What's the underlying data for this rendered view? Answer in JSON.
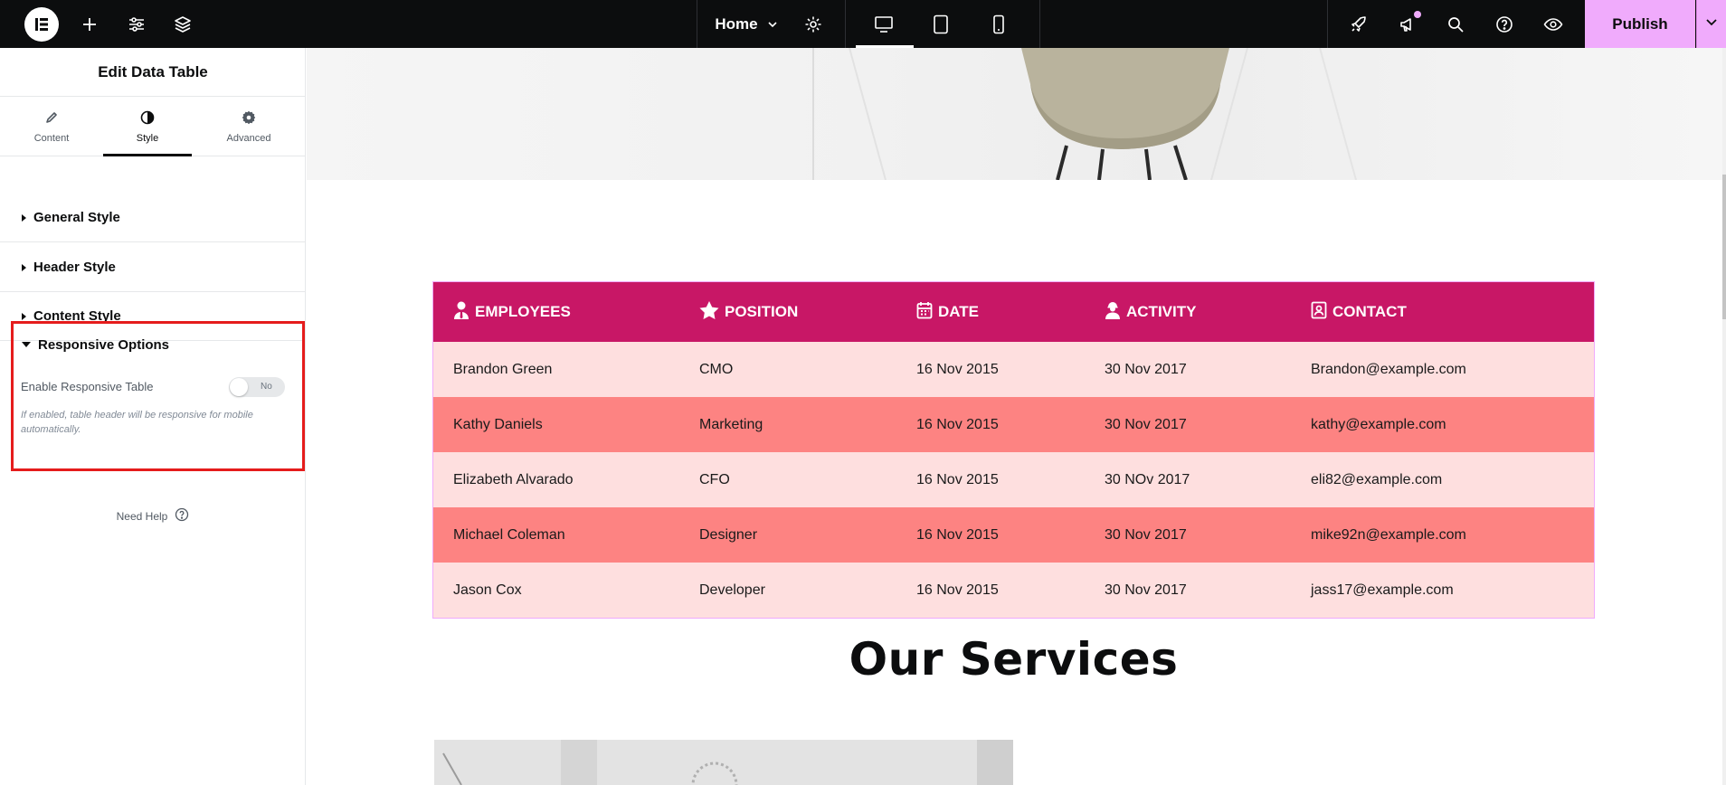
{
  "topbar": {
    "home_label": "Home",
    "publish_label": "Publish",
    "icons": [
      "elementor-logo-icon",
      "add-icon",
      "sliders-icon",
      "layers-icon",
      "chevron-down-icon",
      "gear-icon",
      "desktop-icon",
      "tablet-icon",
      "mobile-icon",
      "rocket-icon",
      "megaphone-icon",
      "search-icon",
      "help-icon",
      "eye-icon",
      "chevron-down-icon"
    ],
    "colors": {
      "bar": "#0c0d0e",
      "publish": "#f0abfc"
    }
  },
  "panel": {
    "title": "Edit Data Table",
    "tabs": [
      {
        "label": "Content",
        "icon": "pencil-icon"
      },
      {
        "label": "Style",
        "icon": "contrast-icon",
        "active": true
      },
      {
        "label": "Advanced",
        "icon": "gear-icon"
      }
    ],
    "sections": [
      {
        "label": "General Style"
      },
      {
        "label": "Header Style"
      },
      {
        "label": "Content Style"
      },
      {
        "label": "Responsive Options",
        "open": true
      }
    ],
    "responsive": {
      "control_label": "Enable Responsive Table",
      "toggle_value": "No",
      "help_text": "If enabled, table header will be responsive for mobile automatically."
    },
    "need_help": "Need Help"
  },
  "table": {
    "colors": {
      "header": "#c81766",
      "row_light": "#fedfdf",
      "row_dark": "#fd8382"
    },
    "headers": [
      {
        "label": "EMPLOYEES",
        "icon": "user-tie-icon"
      },
      {
        "label": "POSITION",
        "icon": "star-icon"
      },
      {
        "label": "DATE",
        "icon": "calendar-icon"
      },
      {
        "label": "ACTIVITY",
        "icon": "user-cog-icon"
      },
      {
        "label": "CONTACT",
        "icon": "contact-card-icon"
      }
    ],
    "rows": [
      [
        "Brandon Green",
        "CMO",
        "16 Nov 2015",
        "30 Nov 2017",
        "Brandon@example.com"
      ],
      [
        "Kathy Daniels",
        "Marketing",
        "16 Nov 2015",
        "30 Nov 2017",
        "kathy@example.com"
      ],
      [
        "Elizabeth Alvarado",
        "CFO",
        "16 Nov 2015",
        "30 NOv 2017",
        "eli82@example.com"
      ],
      [
        "Michael Coleman",
        "Designer",
        "16 Nov 2015",
        "30 Nov 2017",
        "mike92n@example.com"
      ],
      [
        "Jason Cox",
        "Developer",
        "16 Nov 2015",
        "30 Nov 2017",
        "jass17@example.com"
      ]
    ]
  },
  "services": {
    "title": "Our Services"
  }
}
